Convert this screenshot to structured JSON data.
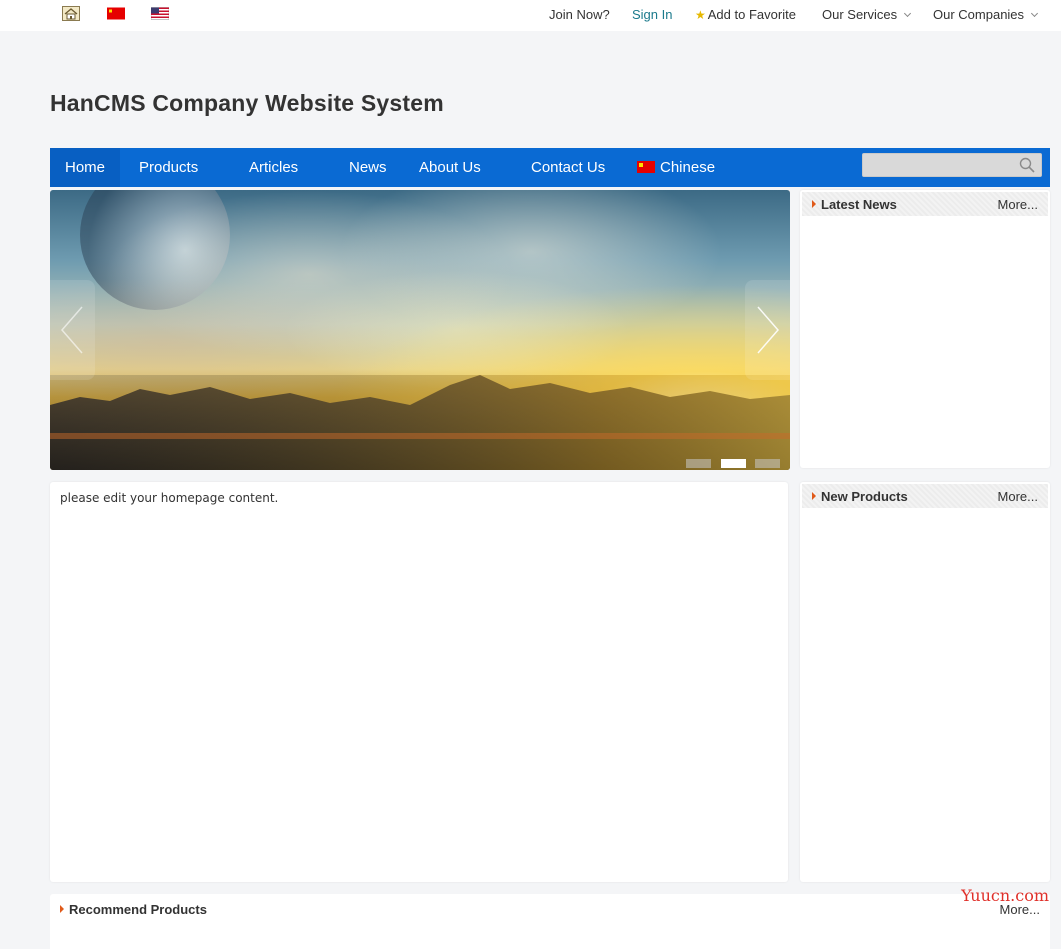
{
  "topbar": {
    "links": {
      "join": "Join Now?",
      "signin": "Sign In",
      "favorite": "Add to Favorite",
      "services": "Our Services",
      "companies": "Our Companies"
    }
  },
  "header": {
    "title": "HanCMS Company Website System"
  },
  "nav": {
    "items": [
      "Home",
      "Products",
      "Articles",
      "News",
      "About Us",
      "Contact Us",
      "Chinese"
    ],
    "search_placeholder": ""
  },
  "banner": {
    "slide_count": 3,
    "active_slide": 2
  },
  "latest_news": {
    "title": "Latest News",
    "more": "More..."
  },
  "new_products": {
    "title": "New Products",
    "more": "More..."
  },
  "main_content": {
    "text": "please edit your homepage content."
  },
  "recommend": {
    "title": "Recommend Products",
    "more": "More..."
  },
  "watermark": "Yuucn.com",
  "colors": {
    "nav": "#0a6ad3",
    "accent_link": "#1b7a8c",
    "bullet": "#e05a1a",
    "background": "#f4f5f7"
  }
}
